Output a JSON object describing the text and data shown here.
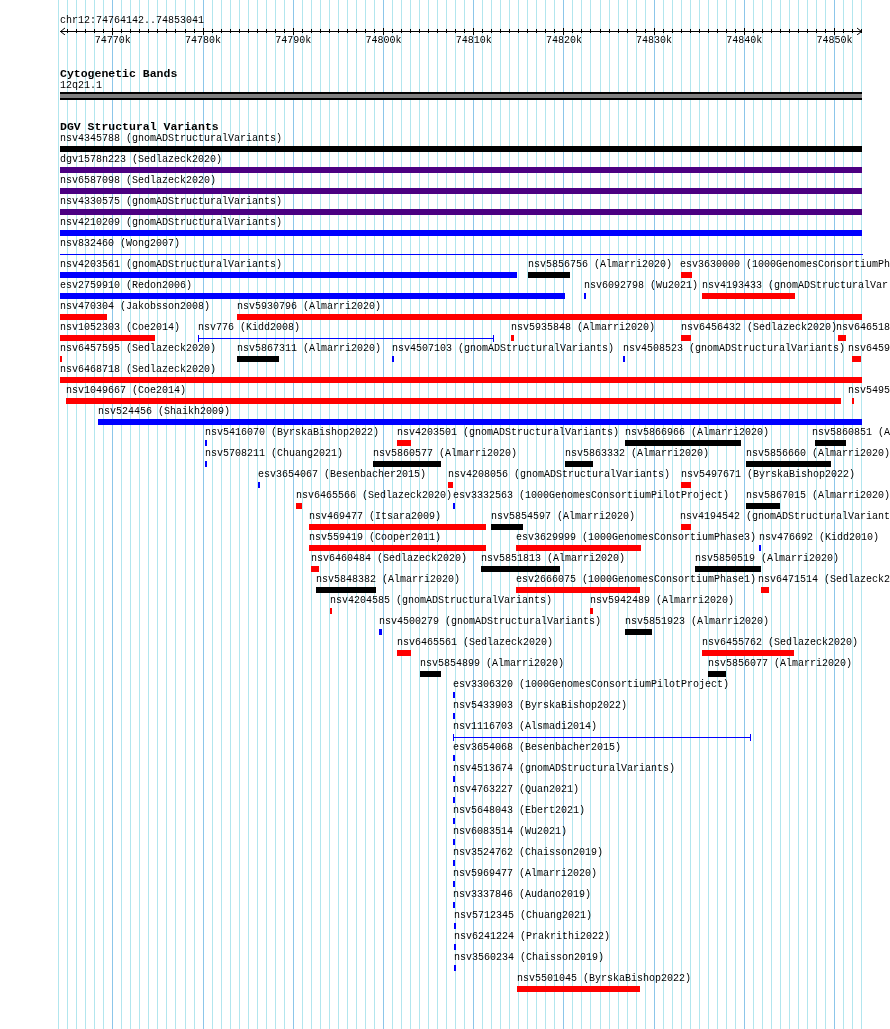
{
  "location": "chr12:74764142..74853041",
  "ruler": {
    "ticks": [
      "74770k",
      "74780k",
      "74790k",
      "74800k",
      "74810k",
      "74820k",
      "74830k",
      "74840k",
      "74850k"
    ]
  },
  "tracks": [
    {
      "title": "Cytogenetic Bands",
      "kind": "bands",
      "features": [
        {
          "label": "12q21.1"
        }
      ]
    },
    {
      "title": "DGV Structural Variants",
      "kind": "variants",
      "rows": [
        {
          "features": [
            {
              "label": "nsv4345788 (gnomADStructuralVariants)",
              "color": "#000000",
              "kind": "bar"
            }
          ]
        },
        {
          "features": [
            {
              "label": "dgv1578n223 (Sedlazeck2020)",
              "color": "#4b0082",
              "kind": "bar"
            }
          ]
        },
        {
          "features": [
            {
              "label": "nsv6587098 (Sedlazeck2020)",
              "color": "#4b0082",
              "kind": "bar"
            }
          ]
        },
        {
          "features": [
            {
              "label": "nsv4330575 (gnomADStructuralVariants)",
              "color": "#4b0082",
              "kind": "bar"
            }
          ]
        },
        {
          "features": [
            {
              "label": "nsv4210209 (gnomADStructuralVariants)",
              "color": "#0000ff",
              "kind": "bar"
            }
          ]
        },
        {
          "features": [
            {
              "label": "nsv832460 (Wong2007)",
              "color": "#0000ff",
              "kind": "line"
            }
          ]
        },
        {
          "features": [
            {
              "label": "nsv4203561 (gnomADStructuralVariants)",
              "color": "#0000ff",
              "kind": "bar"
            },
            {
              "label": "nsv5856756 (Almarri2020)",
              "color": "#000000",
              "kind": "bar"
            },
            {
              "label": "esv3630000 (1000GenomesConsortiumPh",
              "color": "#ff0000",
              "kind": "bar"
            }
          ]
        },
        {
          "features": [
            {
              "label": "esv2759910 (Redon2006)",
              "color": "#0000ff",
              "kind": "bar"
            },
            {
              "label": "nsv6092798 (Wu2021)",
              "color": "#0000ff",
              "kind": "bar"
            },
            {
              "label": "nsv4193433 (gnomADStructuralVar",
              "color": "#ff0000",
              "kind": "bar"
            }
          ]
        },
        {
          "features": [
            {
              "label": "nsv470304 (Jakobsson2008)",
              "color": "#ff0000",
              "kind": "bar"
            },
            {
              "label": "nsv5930796 (Almarri2020)",
              "color": "#ff0000",
              "kind": "bar"
            }
          ]
        },
        {
          "features": [
            {
              "label": "nsv1052303 (Coe2014)",
              "color": "#ff0000",
              "kind": "bar"
            },
            {
              "label": "nsv776 (Kidd2008)",
              "color": "#0000ff",
              "kind": "line"
            },
            {
              "label": "nsv5935848 (Almarri2020)",
              "color": "#ff0000",
              "kind": "bar"
            },
            {
              "label": "nsv6456432 (Sedlazeck2020)",
              "color": "#ff0000",
              "kind": "bar"
            },
            {
              "label": "nsv646518",
              "color": "#ff0000",
              "kind": "bar"
            }
          ]
        },
        {
          "features": [
            {
              "label": "nsv6457595 (Sedlazeck2020)",
              "color": "#ff0000",
              "kind": "bar"
            },
            {
              "label": "nsv5867311 (Almarri2020)",
              "color": "#000000",
              "kind": "bar"
            },
            {
              "label": "nsv4507103 (gnomADStructuralVariants)",
              "color": "#0000ff",
              "kind": "bar"
            },
            {
              "label": "nsv4508523 (gnomADStructuralVariants)",
              "color": "#0000ff",
              "kind": "bar"
            },
            {
              "label": "nsv6459",
              "color": "#ff0000",
              "kind": "bar"
            }
          ]
        },
        {
          "features": [
            {
              "label": "nsv6468718 (Sedlazeck2020)",
              "color": "#ff0000",
              "kind": "bar"
            }
          ]
        },
        {
          "features": [
            {
              "label": "nsv1049667 (Coe2014)",
              "color": "#ff0000",
              "kind": "bar"
            },
            {
              "label": "nsv5495",
              "color": "#ff0000",
              "kind": "bar"
            }
          ]
        },
        {
          "features": [
            {
              "label": "nsv524456 (Shaikh2009)",
              "color": "#0000ff",
              "kind": "bar"
            }
          ]
        },
        {
          "features": [
            {
              "label": "nsv5416070 (ByrskaBishop2022)",
              "color": "#0000ff",
              "kind": "bar"
            },
            {
              "label": "nsv4203501 (gnomADStructuralVariants)",
              "color": "#ff0000",
              "kind": "bar"
            },
            {
              "label": "nsv5866966 (Almarri2020)",
              "color": "#000000",
              "kind": "bar"
            },
            {
              "label": "nsv5860851 (A",
              "color": "#000000",
              "kind": "bar"
            }
          ]
        },
        {
          "features": [
            {
              "label": "nsv5708211 (Chuang2021)",
              "color": "#0000ff",
              "kind": "bar"
            },
            {
              "label": "nsv5860577 (Almarri2020)",
              "color": "#000000",
              "kind": "bar"
            },
            {
              "label": "nsv5863332 (Almarri2020)",
              "color": "#000000",
              "kind": "bar"
            },
            {
              "label": "nsv5856660 (Almarri2020)",
              "color": "#000000",
              "kind": "bar"
            }
          ]
        },
        {
          "features": [
            {
              "label": "esv3654067 (Besenbacher2015)",
              "color": "#0000ff",
              "kind": "bar"
            },
            {
              "label": "nsv4208056 (gnomADStructuralVariants)",
              "color": "#ff0000",
              "kind": "bar"
            },
            {
              "label": "nsv5497671 (ByrskaBishop2022)",
              "color": "#ff0000",
              "kind": "bar"
            }
          ]
        },
        {
          "features": [
            {
              "label": "nsv6465566 (Sedlazeck2020)",
              "color": "#ff0000",
              "kind": "bar"
            },
            {
              "label": "esv3332563 (1000GenomesConsortiumPilotProject)",
              "color": "#0000ff",
              "kind": "bar"
            },
            {
              "label": "nsv5867015 (Almarri2020)",
              "color": "#000000",
              "kind": "bar"
            }
          ]
        },
        {
          "features": [
            {
              "label": "nsv469477 (Itsara2009)",
              "color": "#ff0000",
              "kind": "bar"
            },
            {
              "label": "nsv5854597 (Almarri2020)",
              "color": "#000000",
              "kind": "bar"
            },
            {
              "label": "nsv4194542 (gnomADStructuralVariant",
              "color": "#ff0000",
              "kind": "bar"
            }
          ]
        },
        {
          "features": [
            {
              "label": "nsv559419 (Cooper2011)",
              "color": "#ff0000",
              "kind": "bar"
            },
            {
              "label": "esv3629999 (1000GenomesConsortiumPhase3)",
              "color": "#ff0000",
              "kind": "bar"
            },
            {
              "label": "nsv476692 (Kidd2010)",
              "color": "#0000ff",
              "kind": "bar"
            }
          ]
        },
        {
          "features": [
            {
              "label": "nsv6460484 (Sedlazeck2020)",
              "color": "#ff0000",
              "kind": "bar"
            },
            {
              "label": "nsv5851813 (Almarri2020)",
              "color": "#000000",
              "kind": "bar"
            },
            {
              "label": "nsv5850519 (Almarri2020)",
              "color": "#000000",
              "kind": "bar"
            }
          ]
        },
        {
          "features": [
            {
              "label": "nsv5848382 (Almarri2020)",
              "color": "#000000",
              "kind": "bar"
            },
            {
              "label": "esv2666075 (1000GenomesConsortiumPhase1)",
              "color": "#ff0000",
              "kind": "bar"
            },
            {
              "label": "nsv6471514 (Sedlazeck2",
              "color": "#ff0000",
              "kind": "bar"
            }
          ]
        },
        {
          "features": [
            {
              "label": "nsv4204585 (gnomADStructuralVariants)",
              "color": "#ff0000",
              "kind": "bar"
            },
            {
              "label": "nsv5942489 (Almarri2020)",
              "color": "#ff0000",
              "kind": "bar"
            }
          ]
        },
        {
          "features": [
            {
              "label": "nsv4500279 (gnomADStructuralVariants)",
              "color": "#0000ff",
              "kind": "bar"
            },
            {
              "label": "nsv5851923 (Almarri2020)",
              "color": "#000000",
              "kind": "bar"
            }
          ]
        },
        {
          "features": [
            {
              "label": "nsv6465561 (Sedlazeck2020)",
              "color": "#ff0000",
              "kind": "bar"
            },
            {
              "label": "nsv6455762 (Sedlazeck2020)",
              "color": "#ff0000",
              "kind": "bar"
            }
          ]
        },
        {
          "features": [
            {
              "label": "nsv5854899 (Almarri2020)",
              "color": "#000000",
              "kind": "bar"
            },
            {
              "label": "nsv5856077 (Almarri2020)",
              "color": "#000000",
              "kind": "bar"
            }
          ]
        },
        {
          "features": [
            {
              "label": "esv3306320 (1000GenomesConsortiumPilotProject)",
              "color": "#0000ff",
              "kind": "bar"
            }
          ]
        },
        {
          "features": [
            {
              "label": "nsv5433903 (ByrskaBishop2022)",
              "color": "#0000ff",
              "kind": "bar"
            }
          ]
        },
        {
          "features": [
            {
              "label": "nsv1116703 (Alsmadi2014)",
              "color": "#0000ff",
              "kind": "line"
            }
          ]
        },
        {
          "features": [
            {
              "label": "esv3654068 (Besenbacher2015)",
              "color": "#0000ff",
              "kind": "bar"
            }
          ]
        },
        {
          "features": [
            {
              "label": "nsv4513674 (gnomADStructuralVariants)",
              "color": "#0000ff",
              "kind": "bar"
            }
          ]
        },
        {
          "features": [
            {
              "label": "nsv4763227 (Quan2021)",
              "color": "#0000ff",
              "kind": "bar"
            }
          ]
        },
        {
          "features": [
            {
              "label": "nsv5648043 (Ebert2021)",
              "color": "#0000ff",
              "kind": "bar"
            }
          ]
        },
        {
          "features": [
            {
              "label": "nsv6083514 (Wu2021)",
              "color": "#0000ff",
              "kind": "bar"
            }
          ]
        },
        {
          "features": [
            {
              "label": "nsv3524762 (Chaisson2019)",
              "color": "#0000ff",
              "kind": "bar"
            }
          ]
        },
        {
          "features": [
            {
              "label": "nsv5969477 (Almarri2020)",
              "color": "#0000ff",
              "kind": "bar"
            }
          ]
        },
        {
          "features": [
            {
              "label": "nsv3337846 (Audano2019)",
              "color": "#0000ff",
              "kind": "bar"
            }
          ]
        },
        {
          "features": [
            {
              "label": "nsv5712345 (Chuang2021)",
              "color": "#0000ff",
              "kind": "bar"
            }
          ]
        },
        {
          "features": [
            {
              "label": "nsv6241224 (Prakrithi2022)",
              "color": "#0000ff",
              "kind": "bar"
            }
          ]
        },
        {
          "features": [
            {
              "label": "nsv3560234 (Chaisson2019)",
              "color": "#0000ff",
              "kind": "bar"
            }
          ]
        },
        {
          "features": [
            {
              "label": "nsv5501045 (ByrskaBishop2022)",
              "color": "#ff0000",
              "kind": "bar"
            }
          ]
        }
      ]
    }
  ]
}
